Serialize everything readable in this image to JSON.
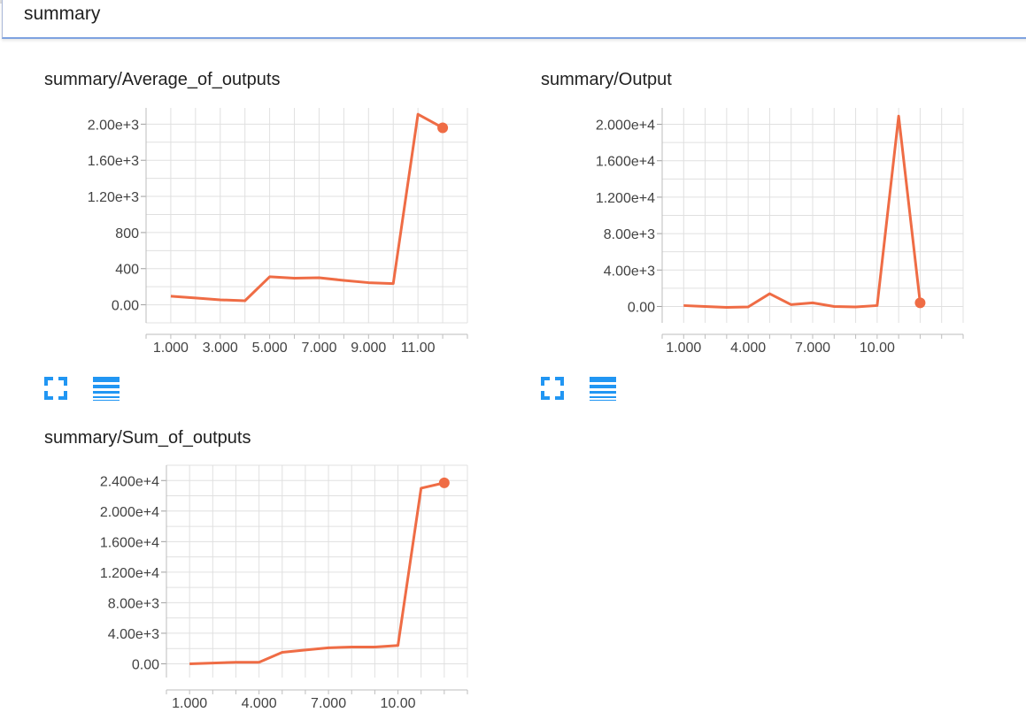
{
  "search": {
    "value": "summary"
  },
  "charts": [
    {
      "title": "summary/Average_of_outputs",
      "chart_data": {
        "type": "line",
        "title": "summary/Average_of_outputs",
        "xlabel": "",
        "ylabel": "",
        "x": [
          1,
          2,
          3,
          4,
          5,
          6,
          7,
          8,
          9,
          10,
          11,
          12
        ],
        "series": [
          {
            "values": [
              95,
              75,
              55,
              45,
              310,
              295,
              300,
              270,
              245,
              235,
              2110,
              1960
            ]
          }
        ],
        "xlim": [
          0,
          13
        ],
        "ylim": [
          -200,
          2180
        ],
        "x_ticks": [
          1,
          3,
          5,
          7,
          9,
          11
        ],
        "x_tick_labels": [
          "1.000",
          "3.000",
          "5.000",
          "7.000",
          "9.000",
          "11.00"
        ],
        "y_ticks": [
          0,
          400,
          800,
          1200,
          1600,
          2000
        ],
        "y_tick_labels": [
          "0.00",
          "400",
          "800",
          "1.20e+3",
          "1.60e+3",
          "2.00e+3"
        ],
        "grid": true,
        "line_color": "#ef6c45"
      }
    },
    {
      "title": "summary/Output",
      "chart_data": {
        "type": "line",
        "title": "summary/Output",
        "xlabel": "",
        "ylabel": "",
        "x": [
          1,
          2,
          3,
          4,
          5,
          6,
          7,
          8,
          9,
          10,
          11,
          12
        ],
        "series": [
          {
            "values": [
              100,
              0,
              -100,
              -50,
              1400,
              200,
              400,
              0,
              -50,
              100,
              20900,
              400
            ]
          }
        ],
        "xlim": [
          0,
          14
        ],
        "ylim": [
          -1800,
          21800
        ],
        "x_ticks": [
          1,
          4,
          7,
          10
        ],
        "x_tick_labels": [
          "1.000",
          "4.000",
          "7.000",
          "10.00"
        ],
        "y_ticks": [
          0,
          4000,
          8000,
          12000,
          16000,
          20000
        ],
        "y_tick_labels": [
          "0.00",
          "4.00e+3",
          "8.00e+3",
          "1.200e+4",
          "1.600e+4",
          "2.000e+4"
        ],
        "grid": true,
        "line_color": "#ef6c45"
      }
    },
    {
      "title": "summary/Sum_of_outputs",
      "chart_data": {
        "type": "line",
        "title": "summary/Sum_of_outputs",
        "xlabel": "",
        "ylabel": "",
        "x": [
          1,
          2,
          3,
          4,
          5,
          6,
          7,
          8,
          9,
          10,
          11,
          12
        ],
        "series": [
          {
            "values": [
              0,
              100,
              200,
              200,
              1500,
              1800,
              2100,
              2200,
              2200,
              2400,
              23000,
              23700
            ]
          }
        ],
        "xlim": [
          0,
          13
        ],
        "ylim": [
          -1800,
          26000
        ],
        "x_ticks": [
          1,
          4,
          7,
          10
        ],
        "x_tick_labels": [
          "1.000",
          "4.000",
          "7.000",
          "10.00"
        ],
        "y_ticks": [
          0,
          4000,
          8000,
          12000,
          16000,
          20000,
          24000
        ],
        "y_tick_labels": [
          "0.00",
          "4.00e+3",
          "8.00e+3",
          "1.200e+4",
          "1.600e+4",
          "2.000e+4",
          "2.400e+4"
        ],
        "grid": true,
        "line_color": "#ef6c45"
      }
    }
  ],
  "actions": {
    "fullscreen_icon": "fullscreen-icon",
    "data_icon": "data-table-icon",
    "accent": "#2196f3"
  }
}
